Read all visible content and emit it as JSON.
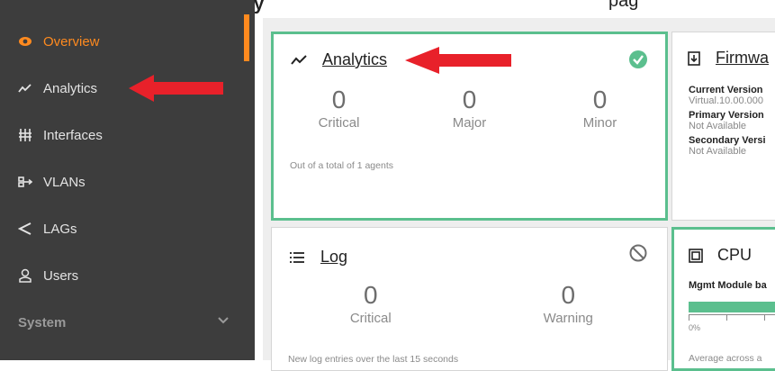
{
  "header": {
    "cropped_glyph": "y",
    "cropped_text": "pag"
  },
  "sidebar": {
    "items": [
      {
        "label": "Overview",
        "icon": "eye-icon"
      },
      {
        "label": "Analytics",
        "icon": "trend-icon"
      },
      {
        "label": "Interfaces",
        "icon": "ports-icon"
      },
      {
        "label": "VLANs",
        "icon": "vlan-icon"
      },
      {
        "label": "LAGs",
        "icon": "share-icon"
      },
      {
        "label": "Users",
        "icon": "user-icon"
      }
    ],
    "section": "System"
  },
  "analytics": {
    "title": "Analytics",
    "counts": [
      {
        "value": "0",
        "label": "Critical"
      },
      {
        "value": "0",
        "label": "Major"
      },
      {
        "value": "0",
        "label": "Minor"
      }
    ],
    "footer": "Out of a total of 1 agents"
  },
  "log": {
    "title": "Log",
    "counts": [
      {
        "value": "0",
        "label": "Critical"
      },
      {
        "value": "0",
        "label": "Warning"
      }
    ],
    "footer": "New log entries over the last 15 seconds"
  },
  "firmware": {
    "title": "Firmwa",
    "rows": [
      {
        "key": "Current Version",
        "value": "Virtual.10.00.000"
      },
      {
        "key": "Primary Version",
        "value": "Not Available"
      },
      {
        "key": "Secondary Versi",
        "value": "Not Available"
      }
    ]
  },
  "cpu": {
    "title": "CPU",
    "subtitle": "Mgmt Module ba",
    "axis_start": "0%",
    "footer": "Average across a"
  },
  "colors": {
    "accent": "#ff8a1f",
    "success": "#5bbf8e",
    "sidebar_bg": "#3d3d3d",
    "annotation_arrow": "#e8212a"
  }
}
